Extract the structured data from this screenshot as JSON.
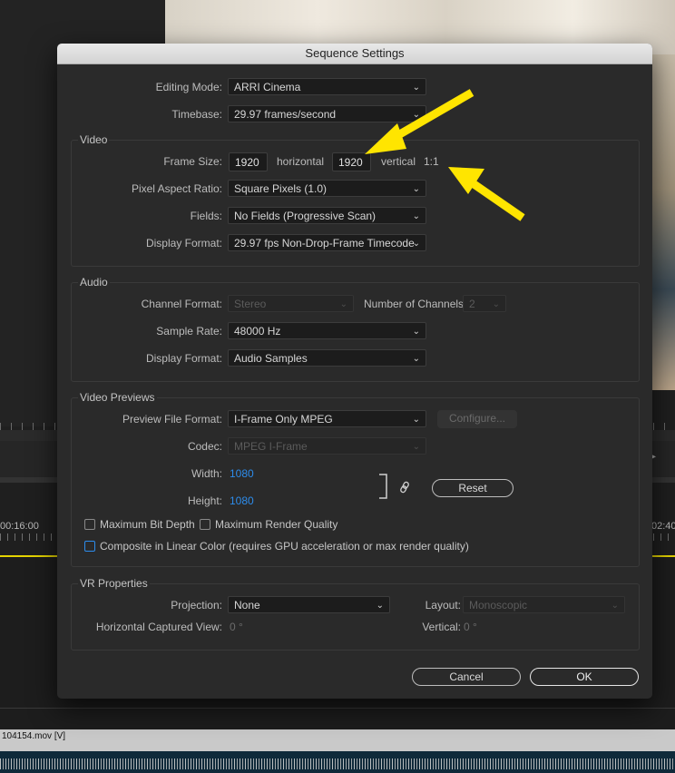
{
  "background": {
    "timecode_left": "00:16:00",
    "timecode_right": "02:40",
    "clip_label": "104154.mov [V]",
    "side_arrow": "▸"
  },
  "dialog": {
    "title": "Sequence Settings",
    "editing_mode": {
      "label": "Editing Mode:",
      "value": "ARRI Cinema"
    },
    "timebase": {
      "label": "Timebase:",
      "value": "29.97  frames/second"
    },
    "video": {
      "title": "Video",
      "frame_size": {
        "label": "Frame Size:",
        "horizontal_value": "1920",
        "horizontal_label": "horizontal",
        "vertical_value": "1920",
        "vertical_label": "vertical",
        "ratio": "1:1"
      },
      "pixel_aspect": {
        "label": "Pixel Aspect Ratio:",
        "value": "Square Pixels (1.0)"
      },
      "fields": {
        "label": "Fields:",
        "value": "No Fields (Progressive Scan)"
      },
      "display_format": {
        "label": "Display Format:",
        "value": "29.97 fps Non-Drop-Frame Timecode"
      }
    },
    "audio": {
      "title": "Audio",
      "channel_format": {
        "label": "Channel Format:",
        "value": "Stereo"
      },
      "num_channels": {
        "label": "Number of Channels:",
        "value": "2"
      },
      "sample_rate": {
        "label": "Sample Rate:",
        "value": "48000 Hz"
      },
      "display_format": {
        "label": "Display Format:",
        "value": "Audio Samples"
      }
    },
    "previews": {
      "title": "Video Previews",
      "file_format": {
        "label": "Preview File Format:",
        "value": "I-Frame Only MPEG"
      },
      "configure_label": "Configure...",
      "codec": {
        "label": "Codec:",
        "value": "MPEG I-Frame"
      },
      "width": {
        "label": "Width:",
        "value": "1080"
      },
      "height": {
        "label": "Height:",
        "value": "1080"
      },
      "reset_label": "Reset",
      "max_bit_depth_label": "Maximum Bit Depth",
      "max_render_quality_label": "Maximum Render Quality",
      "linear_color_label": "Composite in Linear Color (requires GPU acceleration or max render quality)"
    },
    "vr": {
      "title": "VR Properties",
      "projection": {
        "label": "Projection:",
        "value": "None"
      },
      "layout": {
        "label": "Layout:",
        "value": "Monoscopic"
      },
      "horizontal_view": {
        "label": "Horizontal Captured View:",
        "value": "0 °"
      },
      "vertical": {
        "label": "Vertical:",
        "value": "0 °"
      }
    },
    "cancel_label": "Cancel",
    "ok_label": "OK"
  },
  "colors": {
    "annotation_arrow": "#ffe500",
    "accent_blue": "#2d8ceb",
    "timeline_marker": "#e5d400"
  }
}
